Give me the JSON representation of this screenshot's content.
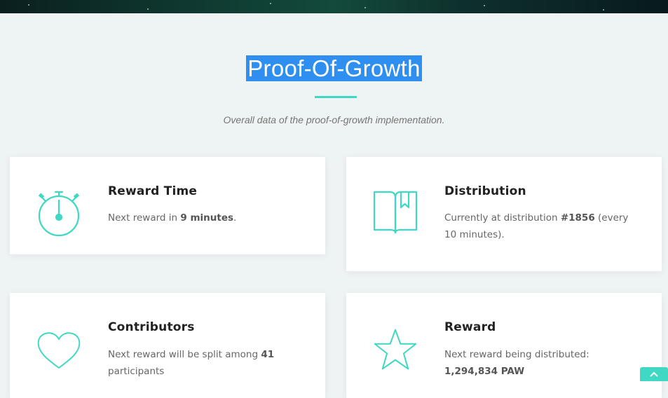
{
  "section": {
    "title": "Proof-Of-Growth",
    "subtitle": "Overall data of the proof-of-growth implementation."
  },
  "accent_color": "#3fd9c3",
  "highlight_color": "#2f8ff0",
  "cards": [
    {
      "icon": "stopwatch-icon",
      "title": "Reward Time",
      "text_pre": "Next reward in ",
      "text_bold": "9 minutes",
      "text_post": "."
    },
    {
      "icon": "book-icon",
      "title": "Distribution",
      "text_pre": "Currently at distribution ",
      "text_bold": "#1856",
      "text_post": " (every 10 minutes)."
    },
    {
      "icon": "heart-icon",
      "title": "Contributors",
      "text_pre": "Next reward will be split among ",
      "text_bold": "41",
      "text_post": " participants"
    },
    {
      "icon": "star-icon",
      "title": "Reward",
      "text_pre": "Next reward being distributed: ",
      "text_bold": "1,294,834 PAW",
      "text_post": ""
    }
  ],
  "scroll_top": {
    "icon": "chevron-up-icon"
  }
}
